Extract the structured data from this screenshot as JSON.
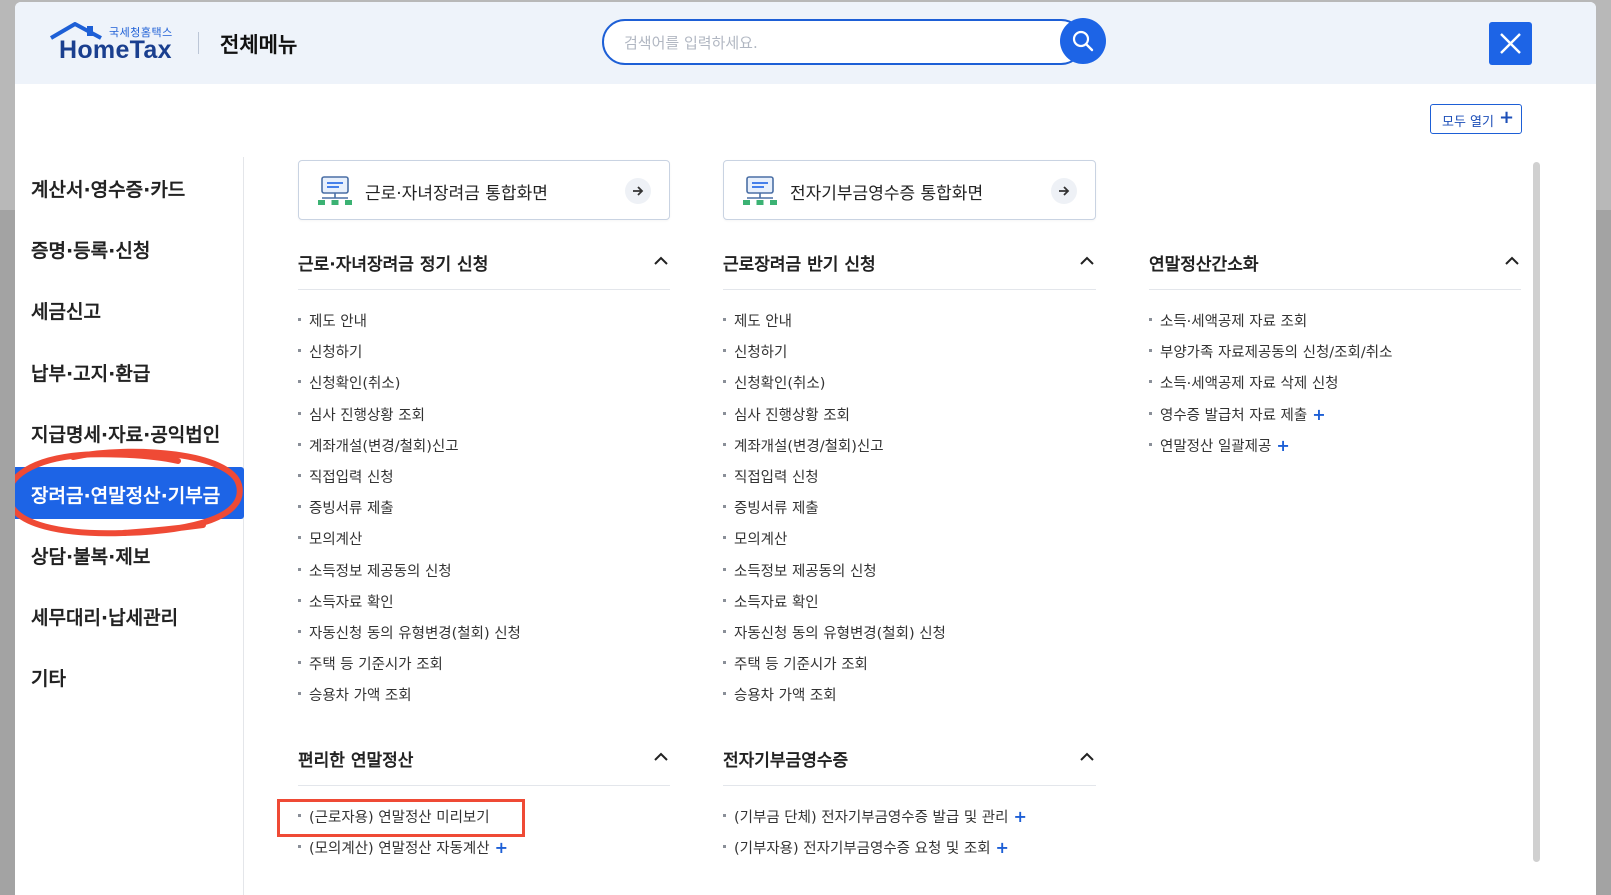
{
  "header": {
    "logo_small": "국세청홈택스",
    "logo_main": "HomeTax",
    "title": "전체메뉴",
    "search_placeholder": "검색어를 입력하세요.",
    "open_all_label": "모두 열기",
    "open_all_plus": "+"
  },
  "sidebar": {
    "items": [
      {
        "label": "계산서·영수증·카드"
      },
      {
        "label": "증명·등록·신청"
      },
      {
        "label": "세금신고"
      },
      {
        "label": "납부·고지·환급"
      },
      {
        "label": "지급명세·자료·공익법인"
      },
      {
        "label": "장려금·연말정산·기부금",
        "active": true
      },
      {
        "label": "상담·불복·제보"
      },
      {
        "label": "세무대리·납세관리"
      },
      {
        "label": "기타"
      }
    ]
  },
  "quick_links": [
    {
      "label": "근로·자녀장려금 통합화면"
    },
    {
      "label": "전자기부금영수증 통합화면"
    }
  ],
  "sections": {
    "s1": {
      "title": "근로·자녀장려금 정기 신청",
      "items": [
        "제도 안내",
        "신청하기",
        "신청확인(취소)",
        "심사 진행상황 조회",
        "계좌개설(변경/철회)신고",
        "직접입력 신청",
        "증빙서류 제출",
        "모의계산",
        "소득정보 제공동의 신청",
        "소득자료 확인",
        "자동신청 동의 유형변경(철회) 신청",
        "주택 등 기준시가 조회",
        "승용차 가액 조회"
      ]
    },
    "s2": {
      "title": "근로장려금 반기 신청",
      "items": [
        "제도 안내",
        "신청하기",
        "신청확인(취소)",
        "심사 진행상황 조회",
        "계좌개설(변경/철회)신고",
        "직접입력 신청",
        "증빙서류 제출",
        "모의계산",
        "소득정보 제공동의 신청",
        "소득자료 확인",
        "자동신청 동의 유형변경(철회) 신청",
        "주택 등 기준시가 조회",
        "승용차 가액 조회"
      ]
    },
    "s3": {
      "title": "연말정산간소화",
      "items": [
        "소득·세액공제 자료 조회",
        "부양가족 자료제공동의 신청/조회/취소",
        "소득·세액공제 자료 삭제 신청",
        "영수증 발급처 자료 제출",
        "연말정산 일괄제공"
      ]
    },
    "s4": {
      "title": "편리한 연말정산",
      "items": [
        "(근로자용) 연말정산 미리보기",
        "(모의계산) 연말정산 자동계산"
      ]
    },
    "s5": {
      "title": "전자기부금영수증",
      "items": [
        "(기부금 단체) 전자기부금영수증 발급 및 관리",
        "(기부자용) 전자기부금영수증 요청 및 조회"
      ]
    }
  },
  "plus_mark": "+",
  "colors": {
    "accent": "#1d64e6",
    "highlight": "#ef4a35"
  }
}
